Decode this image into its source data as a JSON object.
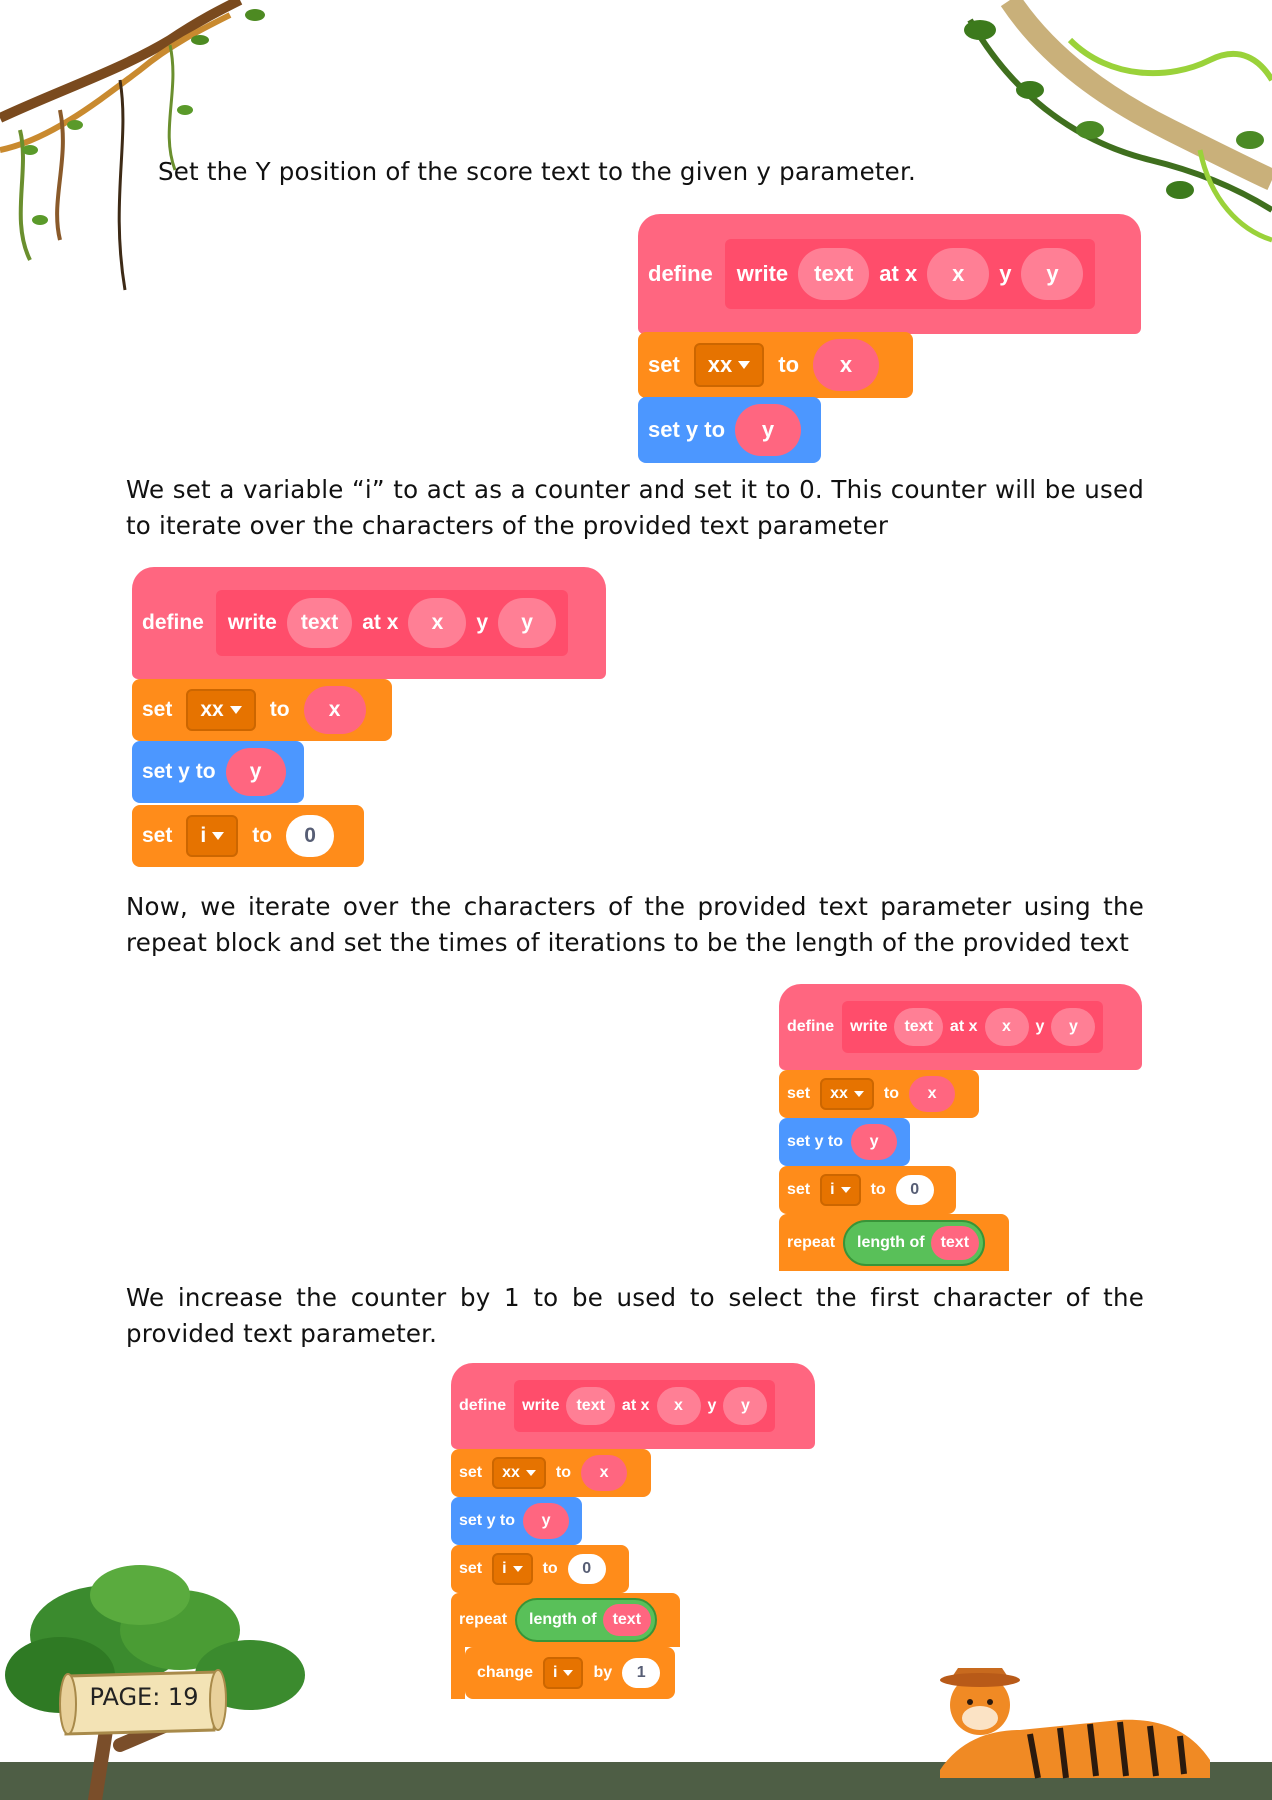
{
  "paragraphs": {
    "p1": "Set the Y position of the score text to the given y parameter.",
    "p2": "We set a variable “i” to act as a counter and set it to 0. This counter will be used to iterate over the characters of the provided text parameter",
    "p3": "Now, we iterate over the characters of the provided text parameter using the repeat block and set the times of iterations to be the length of the provided text",
    "p4": "We increase the counter by 1 to be used to select the first character of the provided text parameter."
  },
  "blocks": {
    "define": "define",
    "write": "write",
    "text": "text",
    "at_x": "at x",
    "x": "x",
    "y": "y",
    "set": "set",
    "xx": "xx",
    "to": "to",
    "set_y_to": "set y to",
    "i": "i",
    "zero": "0",
    "repeat": "repeat",
    "length_of": "length of",
    "change": "change",
    "by": "by",
    "one": "1"
  },
  "footer": {
    "page_label": "PAGE: 19"
  },
  "colors": {
    "define_block": "#ff6680",
    "motion_block": "#4c97ff",
    "variable_block": "#ff8c1a",
    "operator_block": "#59c059",
    "ground": "#4e5e45"
  }
}
